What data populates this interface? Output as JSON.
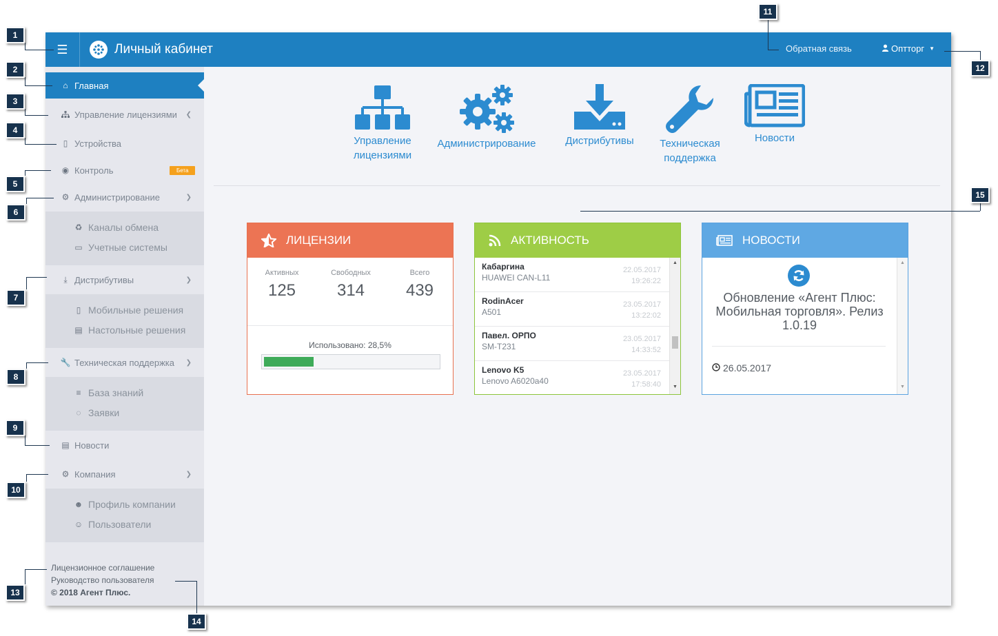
{
  "header": {
    "brand_title": "Личный кабинет",
    "feedback_link": "Обратная связь",
    "user_name": "Оптторг"
  },
  "sidebar": {
    "items": [
      {
        "label": "Главная",
        "icon": "home-icon",
        "active": true
      },
      {
        "label": "Управление лицензиями",
        "icon": "sitemap-icon"
      },
      {
        "label": "Устройства",
        "icon": "mobile-icon"
      },
      {
        "label": "Контроль",
        "icon": "globe-icon",
        "badge": "Бета"
      },
      {
        "label": "Администрирование",
        "icon": "gears-icon"
      },
      {
        "label": "Дистрибутивы",
        "icon": "download-icon"
      },
      {
        "label": "Техническая поддержка",
        "icon": "wrench-icon"
      },
      {
        "label": "Новости",
        "icon": "newspaper-icon"
      },
      {
        "label": "Компания",
        "icon": "gear-icon"
      }
    ],
    "admin_sub": [
      "Каналы обмена",
      "Учетные системы"
    ],
    "dist_sub": [
      "Мобильные решения",
      "Настольные решения"
    ],
    "support_sub": [
      "База знаний",
      "Заявки"
    ],
    "company_sub": [
      "Профиль компании",
      "Пользователи"
    ],
    "footer_links": [
      "Лицензионное соглашение",
      "Руководство пользователя"
    ],
    "copyright": "© 2018 Агент Плюс."
  },
  "tiles": [
    {
      "label_line1": "Управление",
      "label_line2": "лицензиями",
      "icon": "sitemap-icon"
    },
    {
      "label_line1": "Администрирование",
      "label_line2": "",
      "icon": "gears-icon"
    },
    {
      "label_line1": "Дистрибутивы",
      "label_line2": "",
      "icon": "download-icon"
    },
    {
      "label_line1": "Техническая",
      "label_line2": "поддержка",
      "icon": "wrench-icon"
    },
    {
      "label_line1": "Новости",
      "label_line2": "",
      "icon": "newspaper-icon"
    }
  ],
  "licenses": {
    "title": "ЛИЦЕНЗИИ",
    "active_label": "Активных",
    "active_value": "125",
    "free_label": "Свободных",
    "free_value": "314",
    "total_label": "Всего",
    "total_value": "439",
    "usage_label": "Использовано: 28,5%",
    "usage_percent": 28.5
  },
  "activity": {
    "title": "АКТИВНОСТЬ",
    "rows": [
      {
        "name": "Кабаргина",
        "device": "HUAWEI CAN-L11",
        "date": "22.05.2017",
        "time": "19:26:22"
      },
      {
        "name": "RodinAcer",
        "device": "A501",
        "date": "23.05.2017",
        "time": "13:22:02"
      },
      {
        "name": "Павел. ОРПО",
        "device": "SM-T231",
        "date": "23.05.2017",
        "time": "14:33:52"
      },
      {
        "name": "Lenovo K5",
        "device": "Lenovo A6020a40",
        "date": "23.05.2017",
        "time": "17:58:40"
      }
    ]
  },
  "news": {
    "title": "НОВОСТИ",
    "headline": "Обновление «Агент Плюс: Мобильная торговля». Релиз 1.0.19",
    "date": "26.05.2017"
  },
  "callouts": [
    "1",
    "2",
    "3",
    "4",
    "5",
    "6",
    "7",
    "8",
    "9",
    "10",
    "11",
    "12",
    "13",
    "14",
    "15"
  ],
  "colors": {
    "accent": "#1e80c1",
    "licenses_head": "#ec7454",
    "activity_head": "#9ecd46",
    "news_head": "#5fa8e3",
    "progress": "#3fab59",
    "beta_badge": "#f5a11d",
    "callout": "#17324d"
  }
}
